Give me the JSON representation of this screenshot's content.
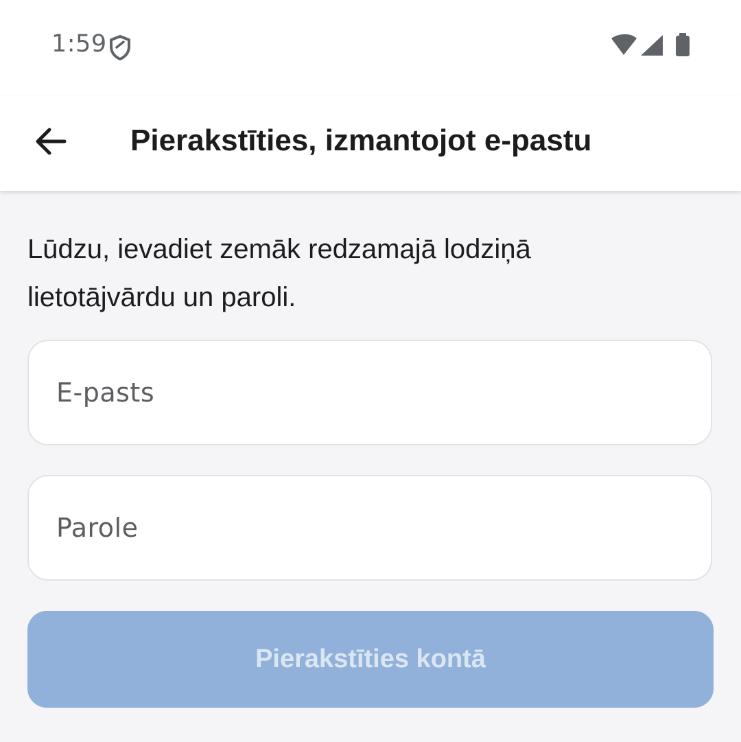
{
  "status_bar": {
    "time": "1:59",
    "icons": [
      "shield-icon",
      "wifi-icon",
      "cellular-signal-icon",
      "battery-icon"
    ]
  },
  "app_bar": {
    "back_icon": "arrow-left-icon",
    "title": "Pierakstīties, izmantojot e-pastu"
  },
  "form": {
    "instructions": "Lūdzu, ievadiet zemāk redzamajā lodziņā lietotājvārdu un paroli.",
    "email": {
      "value": "",
      "placeholder": "E-pasts"
    },
    "password": {
      "value": "",
      "placeholder": "Parole"
    },
    "submit_label": "Pierakstīties kontā"
  },
  "colors": {
    "background": "#f5f5f7",
    "surface": "#ffffff",
    "text_primary": "#1c1c1e",
    "button_disabled": "#91b1da",
    "button_disabled_text": "#dbe6f3"
  }
}
